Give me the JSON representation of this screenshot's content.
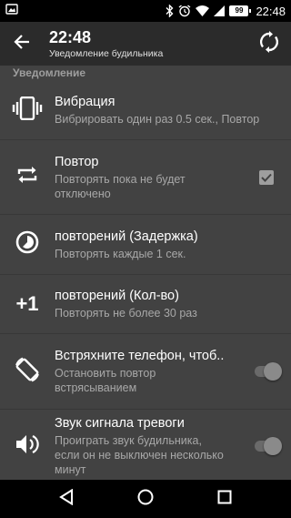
{
  "status_bar": {
    "time": "22:48",
    "battery": "99",
    "icons": [
      "screenshot-icon",
      "bluetooth-icon",
      "alarm-icon",
      "wifi-icon",
      "signal-icon",
      "battery-icon"
    ]
  },
  "app_bar": {
    "title": "22:48",
    "subtitle": "Уведомление будильника",
    "back_icon": "arrow-back-icon",
    "action_icon": "sync-icon"
  },
  "section": {
    "header": "Уведомление"
  },
  "settings": [
    {
      "title": "Вибрация",
      "summary": "Вибрировать один раз 0.5 сек., Повтор",
      "icon": "vibration-icon",
      "widget": "none"
    },
    {
      "title": "Повтор",
      "summary": "Повторять пока не будет отключено",
      "icon": "repeat-icon",
      "widget": "checkbox",
      "checked": true
    },
    {
      "title": "повторений (Задержка)",
      "summary": "Повторять каждые 1 сек.",
      "icon": "timelapse-icon",
      "widget": "none"
    },
    {
      "title": "повторений (Кол-во)",
      "summary": "Повторять не более 30 раз",
      "icon": "plus-one-icon",
      "icon_text": "+1",
      "widget": "none"
    },
    {
      "title": "Встряхните телефон, чтоб..",
      "summary": "Остановить повтор встрясыванием",
      "icon": "screen-rotation-icon",
      "widget": "toggle",
      "enabled": false
    },
    {
      "title": "Звук сигнала тревоги",
      "summary": "Проиграть звук будильника, если он не выключен несколько минут",
      "icon": "volume-up-icon",
      "widget": "toggle",
      "enabled": false
    }
  ],
  "nav_bar": {
    "icons": [
      "back-triangle-icon",
      "home-circle-icon",
      "recents-square-icon"
    ]
  },
  "colors": {
    "background": "#424242",
    "app_bar": "#2b2b2b",
    "section_header": "#9e9e9e",
    "summary_text": "#a8a8a8"
  }
}
